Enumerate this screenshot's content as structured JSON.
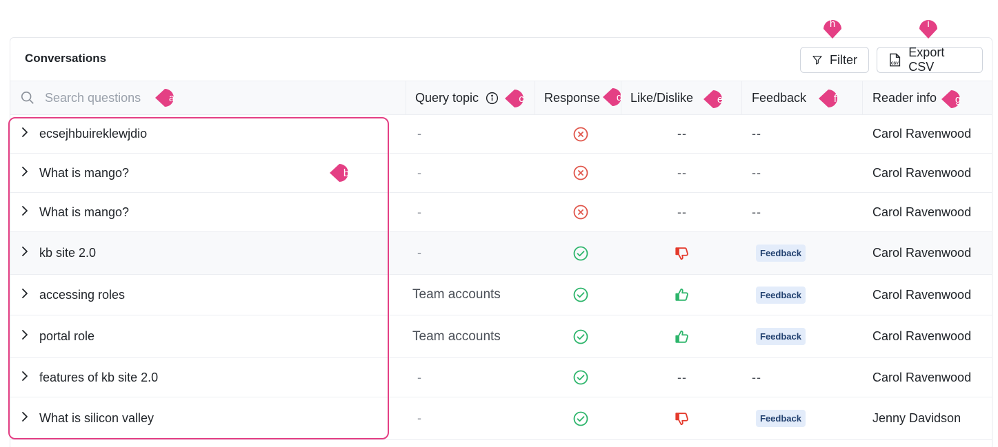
{
  "panel": {
    "title": "Conversations",
    "filter_label": "Filter",
    "export_label": "Export CSV"
  },
  "search": {
    "placeholder": "Search questions"
  },
  "columns": {
    "query_topic": "Query topic",
    "response": "Response",
    "like_dislike": "Like/Dislike",
    "feedback": "Feedback",
    "reader_info": "Reader info"
  },
  "rows": [
    {
      "question": "ecsejhbuireklewjdio",
      "topic": "-",
      "response": "failed",
      "like": "--",
      "feedback": "--",
      "reader": "Carol Ravenwood"
    },
    {
      "question": "What is mango?",
      "topic": "-",
      "response": "failed",
      "like": "--",
      "feedback": "--",
      "reader": "Carol Ravenwood"
    },
    {
      "question": "What is mango?",
      "topic": "-",
      "response": "failed",
      "like": "--",
      "feedback": "--",
      "reader": "Carol Ravenwood"
    },
    {
      "question": "kb site 2.0",
      "topic": "-",
      "response": "success",
      "like": "dislike",
      "feedback": "Feedback",
      "reader": "Carol Ravenwood"
    },
    {
      "question": "accessing roles",
      "topic": "Team accounts",
      "response": "success",
      "like": "like",
      "feedback": "Feedback",
      "reader": "Carol Ravenwood"
    },
    {
      "question": "portal role",
      "topic": "Team accounts",
      "response": "success",
      "like": "like",
      "feedback": "Feedback",
      "reader": "Carol Ravenwood"
    },
    {
      "question": "features of kb site 2.0",
      "topic": "-",
      "response": "success",
      "like": "--",
      "feedback": "--",
      "reader": "Carol Ravenwood"
    },
    {
      "question": "What is silicon valley",
      "topic": "-",
      "response": "success",
      "like": "dislike",
      "feedback": "Feedback",
      "reader": "Jenny Davidson"
    }
  ],
  "markers": [
    "a",
    "b",
    "c",
    "d",
    "e",
    "f",
    "g",
    "h",
    "i"
  ],
  "colors": {
    "marker": "#e43f84",
    "success": "#2db56b",
    "failed": "#e0564b",
    "like": "#2db56b",
    "dislike": "#e43a2c",
    "badge_bg": "#e3ecfa",
    "badge_text": "#21406f"
  },
  "icons": {
    "search": "search-icon",
    "filter": "filter-funnel-icon",
    "export": "csv-file-icon",
    "info": "info-circle-icon",
    "expand": "chevron-right-icon",
    "success": "check-circle-icon",
    "failed": "x-circle-icon",
    "like": "thumbs-up-icon",
    "dislike": "thumbs-down-icon"
  }
}
